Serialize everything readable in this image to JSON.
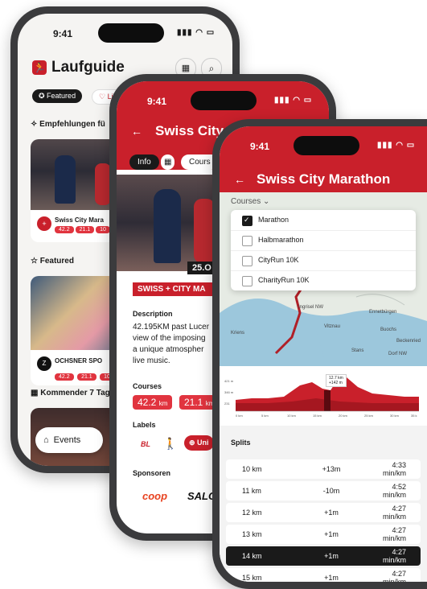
{
  "status": {
    "time": "9:41",
    "icons": "▮▮▮ ◠ ▭"
  },
  "phone1": {
    "app_title": "Laufguide",
    "tab_featured": "Featured",
    "tab_liked": "Lik",
    "section_recommend": "Empfehlungen fü",
    "card1_title": "Swiss City Mara",
    "card1_tags": [
      "42.2",
      "21.1",
      "10"
    ],
    "section_featured": "Featured",
    "card2_title": "OCHSNER SPO",
    "card2_tags": [
      "42.2",
      "21.1",
      "10"
    ],
    "section_upcoming": "Kommender 7 Tag",
    "events_button": "Events"
  },
  "phone2": {
    "title": "Swiss City",
    "tab_info": "Info",
    "tab_courses": "Cours",
    "date_badge": "25.O",
    "banner": "SWISS + CITY MA",
    "description_heading": "Description",
    "description_lines": [
      "42.195KM past Lucer",
      "view of the imposing",
      "a unique atmospher",
      "live music."
    ],
    "courses_heading": "Courses",
    "course1_value": "42.2",
    "course1_unit": "km",
    "course2_value": "21.1",
    "course2_unit": "km",
    "labels_heading": "Labels",
    "label_bl": "BL",
    "label_uni": "Uni",
    "sponsors_heading": "Sponsoren",
    "sponsor1": "COOP",
    "sponsor2": "SALO"
  },
  "phone3": {
    "title": "Swiss City Marathon",
    "courses_dropdown": "Courses",
    "course_options": [
      {
        "label": "Marathon",
        "checked": true
      },
      {
        "label": "Halbmarathon",
        "checked": false
      },
      {
        "label": "CityRun 10K",
        "checked": false
      },
      {
        "label": "CharityRun 10K",
        "checked": false
      }
    ],
    "map_labels": [
      "Ingrisel NW",
      "Ennetbürgen",
      "Vitznau",
      "Buochs",
      "Kriens",
      "Beckenried",
      "Stans",
      "Dorf NW"
    ],
    "elevation_tooltip": [
      "12.7 km",
      "+142 m"
    ],
    "elevation_y_ticks": [
      "421 m",
      "346 m",
      "231"
    ],
    "elevation_x_ticks": [
      "0 km",
      "5 km",
      "10 km",
      "15 km",
      "20 km",
      "25 km",
      "30 km",
      "35 k"
    ],
    "splits_heading": "Splits",
    "splits": [
      {
        "km": "10 km",
        "elev": "+13m",
        "pace": "4:33 min/km",
        "active": false
      },
      {
        "km": "11 km",
        "elev": "-10m",
        "pace": "4:52 min/km",
        "active": false
      },
      {
        "km": "12 km",
        "elev": "+1m",
        "pace": "4:27 min/km",
        "active": false
      },
      {
        "km": "13 km",
        "elev": "+1m",
        "pace": "4:27 min/km",
        "active": false
      },
      {
        "km": "14 km",
        "elev": "+1m",
        "pace": "4:27 min/km",
        "active": true
      },
      {
        "km": "15 km",
        "elev": "+1m",
        "pace": "4:27 min/km",
        "active": false
      }
    ]
  },
  "colors": {
    "brand": "#c9202b",
    "tag": "#e1343f",
    "dark": "#1a1a1a"
  }
}
